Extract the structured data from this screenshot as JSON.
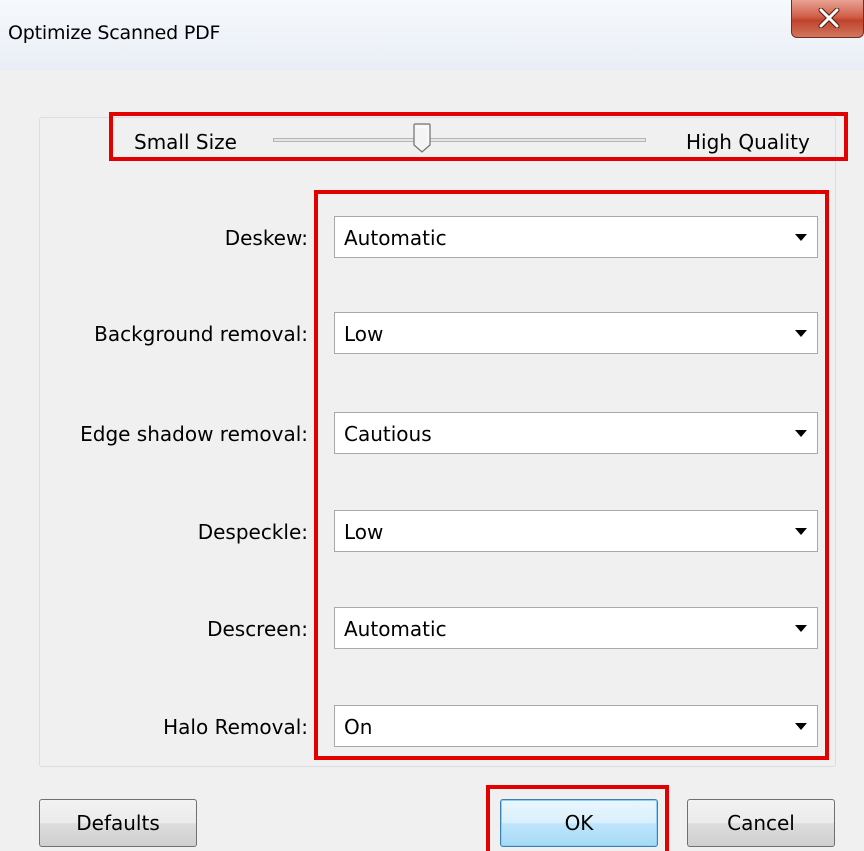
{
  "window": {
    "title": "Optimize Scanned PDF"
  },
  "quality_slider": {
    "min_label": "Small Size",
    "max_label": "High Quality",
    "value_fraction": 0.4
  },
  "settings": [
    {
      "label": "Deskew:",
      "value": "Automatic"
    },
    {
      "label": "Background removal:",
      "value": "Low"
    },
    {
      "label": "Edge shadow removal:",
      "value": "Cautious"
    },
    {
      "label": "Despeckle:",
      "value": "Low"
    },
    {
      "label": "Descreen:",
      "value": "Automatic"
    },
    {
      "label": "Halo Removal:",
      "value": "On"
    }
  ],
  "buttons": {
    "defaults": "Defaults",
    "ok": "OK",
    "cancel": "Cancel"
  },
  "colors": {
    "highlight": "#e30000",
    "close_button": "#c0432b"
  }
}
